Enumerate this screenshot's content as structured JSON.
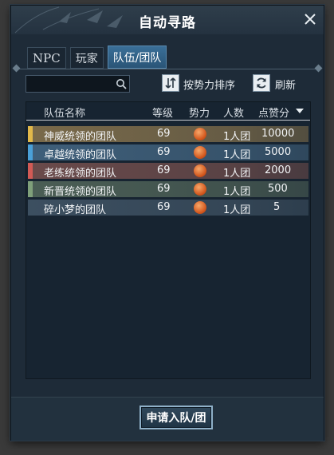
{
  "window": {
    "title": "自动寻路"
  },
  "tabs": [
    {
      "label": "NPC",
      "active": false
    },
    {
      "label": "玩家",
      "active": false
    },
    {
      "label": "队伍/团队",
      "active": true
    }
  ],
  "search": {
    "value": "",
    "placeholder": ""
  },
  "toolbar": {
    "sort_label": "按势力排序",
    "refresh_label": "刷新"
  },
  "table": {
    "columns": [
      "队伍名称",
      "等级",
      "势力",
      "人数",
      "点赞分"
    ],
    "sort_indicator": "descending",
    "rows": [
      {
        "name": "神威统领的团队",
        "level": "69",
        "force_icon": "flame-emblem-icon",
        "members": "1人团",
        "likes": "10000",
        "color": "#7a6a4a",
        "strip": "#e1b84a"
      },
      {
        "name": "卓越统领的团队",
        "level": "69",
        "force_icon": "flame-emblem-icon",
        "members": "1人团",
        "likes": "5000",
        "color": "#3f5f7a",
        "strip": "#4aa0d8"
      },
      {
        "name": "老练统领的团队",
        "level": "69",
        "force_icon": "flame-emblem-icon",
        "members": "1人团",
        "likes": "2000",
        "color": "#6a4a4a",
        "strip": "#d25a55"
      },
      {
        "name": "新晋统领的团队",
        "level": "69",
        "force_icon": "flame-emblem-icon",
        "members": "1人团",
        "likes": "500",
        "color": "#4b5e55",
        "strip": "#7fa07a"
      },
      {
        "name": "碎小梦的团队",
        "level": "69",
        "force_icon": "flame-emblem-icon",
        "members": "1人团",
        "likes": "5",
        "color": "#3c4f60",
        "strip": ""
      }
    ]
  },
  "footer": {
    "apply_label": "申请入队/团"
  }
}
